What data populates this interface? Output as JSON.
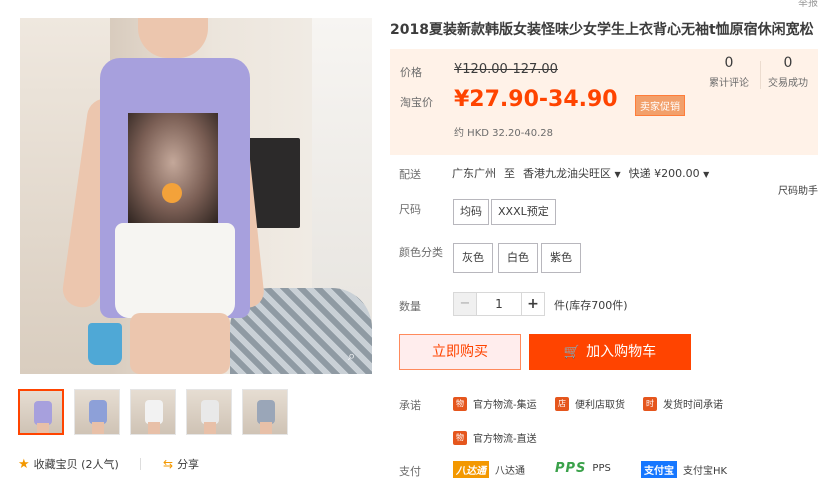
{
  "header": {
    "top_right": "举报"
  },
  "product": {
    "title": "2018夏装新款韩版女装怪味少女学生上衣背心无袖t恤原宿休闲宽松"
  },
  "price": {
    "orig_label": "价格",
    "orig_value": "¥120.00-127.00",
    "tb_label": "淘宝价",
    "tb_value": "¥27.90-34.90",
    "promo": "卖家促销",
    "hkd": "约 HKD 32.20-40.28",
    "stats": [
      {
        "num": "0",
        "label": "累计评论"
      },
      {
        "num": "0",
        "label": "交易成功"
      }
    ]
  },
  "shipping": {
    "label": "配送",
    "from": "广东广州",
    "to_word": "至",
    "to": "香港九龙油尖旺区",
    "express": "快递 ¥200.00",
    "size_helper": "尺码助手"
  },
  "size": {
    "label": "尺码",
    "options": [
      "均码",
      "XXXL预定"
    ]
  },
  "color": {
    "label": "颜色分类",
    "options": [
      "灰色",
      "白色",
      "紫色"
    ]
  },
  "quantity": {
    "label": "数量",
    "minus": "−",
    "value": "1",
    "plus": "+",
    "stock": "件(库存700件)"
  },
  "actions": {
    "buy_now": "立即购买",
    "add_cart": "加入购物车"
  },
  "promise": {
    "label": "承诺",
    "items": [
      "官方物流-集运",
      "便利店取货",
      "发货时间承诺",
      "官方物流-直送"
    ]
  },
  "payment": {
    "label": "支付",
    "items": [
      {
        "logo": "八达通",
        "name": "八达通"
      },
      {
        "logo": "PPS",
        "name": "PPS"
      },
      {
        "logo": "支付宝",
        "name": "支付宝HK"
      }
    ]
  },
  "gallery": {
    "favorite": "收藏宝贝 (2人气)",
    "share": "分享",
    "thumb_colors": [
      "#a7a0dd",
      "#8da0d8",
      "#f2f2f2",
      "#e9e9e9",
      "#9aa6b8"
    ]
  },
  "colors": {
    "accent": "#ff4400",
    "price_bg": "#fff2e8"
  }
}
